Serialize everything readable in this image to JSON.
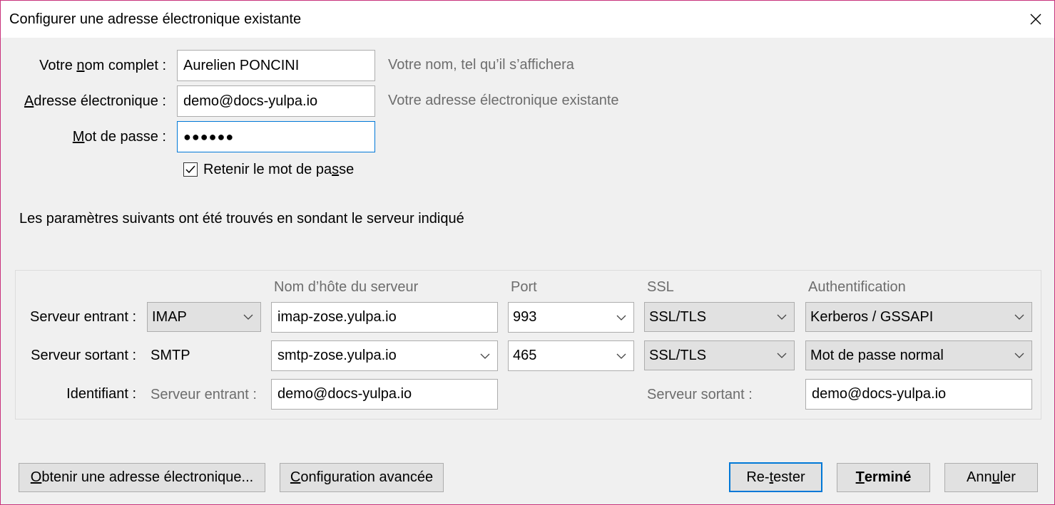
{
  "window": {
    "title": "Configurer une adresse électronique existante"
  },
  "identity": {
    "name_label": {
      "pre": "Votre ",
      "u": "n",
      "post": "om complet :"
    },
    "name_value": "Aurelien PONCINI",
    "name_hint": "Votre nom, tel qu’il s’affichera",
    "email_label": {
      "pre": "",
      "u": "A",
      "post": "dresse électronique :"
    },
    "email_value": "demo@docs-yulpa.io",
    "email_hint": "Votre adresse électronique existante",
    "password_label": {
      "pre": "",
      "u": "M",
      "post": "ot de passe :"
    },
    "password_value": "●●●●●●",
    "remember_label": {
      "pre": "Retenir le mot de pa",
      "u": "s",
      "post": "se"
    },
    "remember_checked": true
  },
  "status_message": "Les paramètres suivants ont été trouvés en sondant le serveur indiqué",
  "servers": {
    "headers": {
      "hostname": "Nom d’hôte du serveur",
      "port": "Port",
      "ssl": "SSL",
      "auth": "Authentification"
    },
    "incoming": {
      "label": "Serveur entrant :",
      "protocol": "IMAP",
      "hostname": "imap-zose.yulpa.io",
      "port": "993",
      "ssl": "SSL/TLS",
      "auth": "Kerberos / GSSAPI"
    },
    "outgoing": {
      "label": "Serveur sortant :",
      "protocol": "SMTP",
      "hostname": "smtp-zose.yulpa.io",
      "port": "465",
      "ssl": "SSL/TLS",
      "auth": "Mot de passe normal"
    },
    "username": {
      "label": "Identifiant :",
      "incoming_label": "Serveur entrant :",
      "incoming_value": "demo@docs-yulpa.io",
      "outgoing_label": "Serveur sortant :",
      "outgoing_value": "demo@docs-yulpa.io"
    }
  },
  "buttons": {
    "get_email": {
      "pre": "",
      "u": "O",
      "post": "btenir une adresse électronique..."
    },
    "advanced": {
      "pre": "",
      "u": "C",
      "post": "onfiguration avancée"
    },
    "retest": {
      "pre": "Re-",
      "u": "t",
      "post": "ester"
    },
    "done": {
      "pre": "",
      "u": "T",
      "post": "erminé"
    },
    "cancel": {
      "pre": "Ann",
      "u": "u",
      "post": "ler"
    }
  },
  "colors": {
    "accent": "#0078d7",
    "window_border": "#c8327c",
    "hint_text": "#6d6d6d"
  }
}
